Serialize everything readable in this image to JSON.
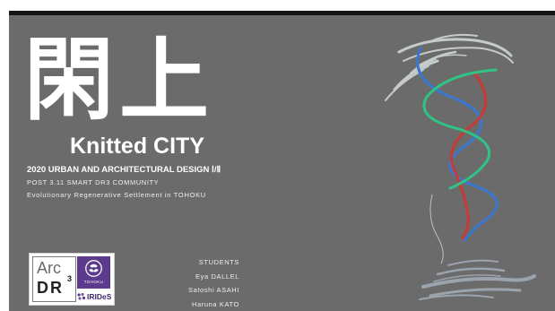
{
  "slide": {
    "title_kanji": "閑上",
    "subtitle": "Knitted CITY",
    "course": "2020 URBAN AND ARCHITECTURAL DESIGN Ⅰ/Ⅱ",
    "post": "POST 3.11 SMART DR3 COMMUNITY",
    "evolutionary": "Evolutionary Regenerative Settlement in TOHOKU"
  },
  "students": {
    "heading": "STUDENTS",
    "names": [
      "Eya DALLEL",
      "Satoshi ASAHI",
      "Haruna KATO"
    ]
  },
  "logos": {
    "arc": "Arc",
    "dr": "DR",
    "dr_sup": "3",
    "tohoku": "TOHOKU",
    "irides": "IRIDeS"
  },
  "colors": {
    "background": "#6b6b6b",
    "strand_red": "#c83a36",
    "strand_blue": "#3a78d0",
    "strand_green": "#2fc486",
    "tohoku_purple": "#5d3b8c"
  }
}
